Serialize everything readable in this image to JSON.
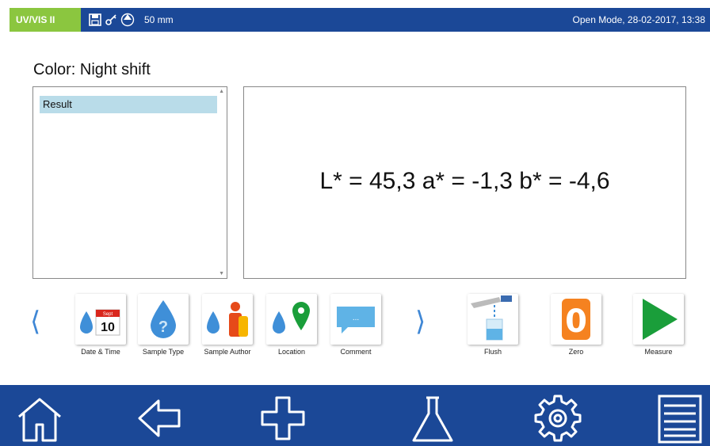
{
  "topbar": {
    "mode": "UV/VIS II",
    "path_length": "50 mm",
    "status": "Open Mode, 28-02-2017, 13:38"
  },
  "title": "Color: Night shift",
  "list": {
    "items": [
      "Result"
    ]
  },
  "result": {
    "text": "L* = 45,3 a* = -1,3 b* = -4,6"
  },
  "toolbar": {
    "prev_label": "⟨",
    "next_label": "⟩",
    "tools": [
      {
        "label": "Date & Time",
        "icon": "date-time-icon",
        "calendar_month": "Sept",
        "calendar_day": "10"
      },
      {
        "label": "Sample Type",
        "icon": "sample-type-icon"
      },
      {
        "label": "Sample Author",
        "icon": "sample-author-icon"
      },
      {
        "label": "Location",
        "icon": "location-icon"
      },
      {
        "label": "Comment",
        "icon": "comment-icon",
        "bubble_text": "..."
      },
      {
        "label": "Flush",
        "icon": "flush-icon"
      },
      {
        "label": "Zero",
        "icon": "zero-icon",
        "glyph": "0"
      },
      {
        "label": "Measure",
        "icon": "play-icon"
      }
    ]
  },
  "colors": {
    "brand_blue": "#1b4897",
    "mode_green": "#8bc63f",
    "selection": "#b9dce9",
    "drop_blue": "#3f8fd8",
    "zero_orange": "#f58220",
    "measure_green": "#1a9e3a"
  },
  "nav": [
    "home-icon",
    "back-icon",
    "add-icon",
    "flask-icon",
    "settings-icon",
    "menu-icon"
  ]
}
